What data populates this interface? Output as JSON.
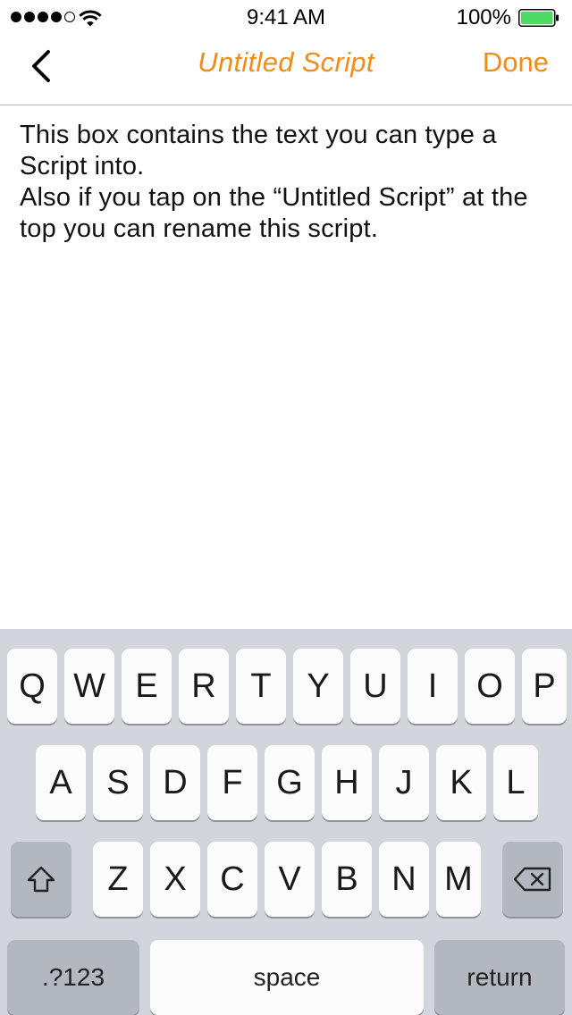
{
  "status_bar": {
    "time": "9:41 AM",
    "battery_percent": "100%",
    "battery_level": 1.0,
    "signal_bars_filled": 4,
    "signal_bars_total": 5
  },
  "nav": {
    "title": "Untitled Script",
    "done_label": "Done",
    "back_icon": "chevron-left-icon",
    "accent_color": "#f08c1a"
  },
  "editor": {
    "lines": [
      "This box contains the text you can type a Script into.",
      "Also if you tap on the “Untitled Script” at the top you can rename this script."
    ]
  },
  "keyboard": {
    "row1": [
      "Q",
      "W",
      "E",
      "R",
      "T",
      "Y",
      "U",
      "I",
      "O",
      "P"
    ],
    "row2": [
      "A",
      "S",
      "D",
      "F",
      "G",
      "H",
      "J",
      "K",
      "L"
    ],
    "row3": [
      "Z",
      "X",
      "C",
      "V",
      "B",
      "N",
      "M"
    ],
    "shift_icon": "shift-icon",
    "delete_icon": "delete-backspace-icon",
    "numbers_label": ".?123",
    "space_label": "space",
    "return_label": "return"
  }
}
